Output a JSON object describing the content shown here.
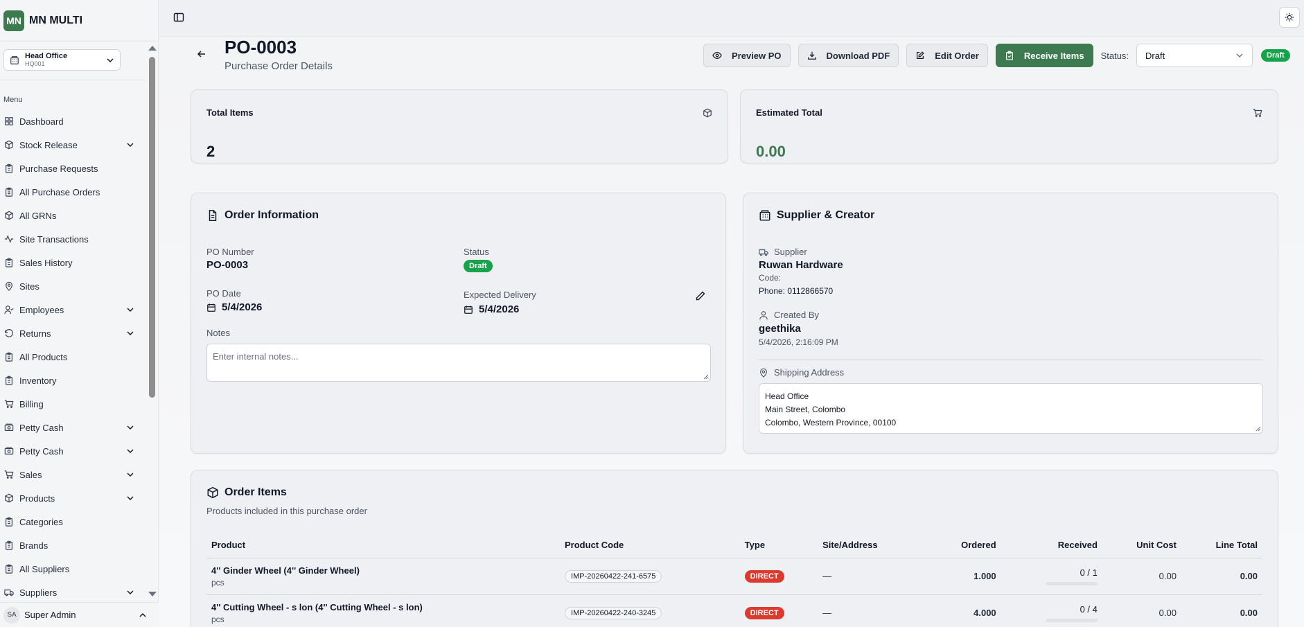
{
  "app": {
    "logo": "MN",
    "name": "MN MULTI"
  },
  "branch": {
    "name": "Head Office",
    "code": "HQ001"
  },
  "sidebar": {
    "menu_label": "Menu",
    "items": [
      {
        "label": "Dashboard",
        "icon": "grid-icon",
        "expandable": false
      },
      {
        "label": "Stock Release",
        "icon": "box-icon",
        "expandable": true
      },
      {
        "label": "Purchase Requests",
        "icon": "clipboard-icon",
        "expandable": false
      },
      {
        "label": "All Purchase Orders",
        "icon": "clipboard-icon",
        "expandable": false
      },
      {
        "label": "All GRNs",
        "icon": "box-icon",
        "expandable": false
      },
      {
        "label": "Site Transactions",
        "icon": "activity-icon",
        "expandable": false
      },
      {
        "label": "Sales History",
        "icon": "clipboard-icon",
        "expandable": false
      },
      {
        "label": "Sites",
        "icon": "map-pin-icon",
        "expandable": false
      },
      {
        "label": "Employees",
        "icon": "user-check-icon",
        "expandable": true
      },
      {
        "label": "Returns",
        "icon": "rotate-ccw-icon",
        "expandable": true
      },
      {
        "label": "All Products",
        "icon": "clipboard-icon",
        "expandable": false
      },
      {
        "label": "Inventory",
        "icon": "clipboard-icon",
        "expandable": false
      },
      {
        "label": "Billing",
        "icon": "cart-icon",
        "expandable": false
      },
      {
        "label": "Petty Cash",
        "icon": "cash-icon",
        "expandable": true
      },
      {
        "label": "Petty Cash",
        "icon": "cash-icon",
        "expandable": true
      },
      {
        "label": "Sales",
        "icon": "cart-icon",
        "expandable": true
      },
      {
        "label": "Products",
        "icon": "box-icon",
        "expandable": true
      },
      {
        "label": "Categories",
        "icon": "clipboard-icon",
        "expandable": false
      },
      {
        "label": "Brands",
        "icon": "clipboard-icon",
        "expandable": false
      },
      {
        "label": "All Suppliers",
        "icon": "clipboard-icon",
        "expandable": false
      },
      {
        "label": "Suppliers",
        "icon": "truck-icon",
        "expandable": true
      }
    ]
  },
  "user": {
    "initials": "SA",
    "name": "Super Admin"
  },
  "page": {
    "title": "PO-0003",
    "subtitle": "Purchase Order Details"
  },
  "actions": {
    "preview": "Preview PO",
    "download": "Download PDF",
    "edit": "Edit Order",
    "receive": "Receive Items",
    "status_label": "Status:",
    "status_value": "Draft",
    "status_badge": "Draft"
  },
  "stats": {
    "total_items_label": "Total Items",
    "total_items_value": "2",
    "estimated_total_label": "Estimated Total",
    "estimated_total_value": "0.00"
  },
  "order_info": {
    "title": "Order Information",
    "po_number_label": "PO Number",
    "po_number": "PO-0003",
    "status_label": "Status",
    "status": "Draft",
    "po_date_label": "PO Date",
    "po_date": "5/4/2026",
    "expected_label": "Expected Delivery",
    "expected": "5/4/2026",
    "notes_label": "Notes",
    "notes_placeholder": "Enter internal notes..."
  },
  "supplier": {
    "title": "Supplier & Creator",
    "supplier_label": "Supplier",
    "supplier_name": "Ruwan Hardware",
    "code_line": "Code:",
    "phone_line": "Phone: 0112866570",
    "created_label": "Created By",
    "created_by": "geethika",
    "created_at": "5/4/2026, 2:16:09 PM",
    "shipping_label": "Shipping Address",
    "address_1": "Head Office",
    "address_2": "Main Street, Colombo",
    "address_3": "Colombo, Western Province, 00100"
  },
  "order_items": {
    "title": "Order Items",
    "subtitle": "Products included in this purchase order",
    "columns": [
      "Product",
      "Product Code",
      "Type",
      "Site/Address",
      "Ordered",
      "Received",
      "Unit Cost",
      "Line Total"
    ],
    "rows": [
      {
        "product": "4'' Ginder Wheel (4'' Ginder Wheel)",
        "unit": "pcs",
        "code": "IMP-20260422-241-6575",
        "type": "DIRECT",
        "site": "—",
        "ordered": "1.000",
        "received": "0 / 1",
        "received_fraction": 0,
        "unit_cost": "0.00",
        "line_total": "0.00"
      },
      {
        "product": "4'' Cutting Wheel - s lon (4'' Cutting Wheel - s lon)",
        "unit": "pcs",
        "code": "IMP-20260422-240-3245",
        "type": "DIRECT",
        "site": "—",
        "ordered": "4.000",
        "received": "0 / 4",
        "received_fraction": 0,
        "unit_cost": "0.00",
        "line_total": "0.00"
      }
    ]
  },
  "colors": {
    "brand": "#3d7a4f",
    "badge_green": "#16a34a",
    "type_red": "#dc3a2f"
  }
}
